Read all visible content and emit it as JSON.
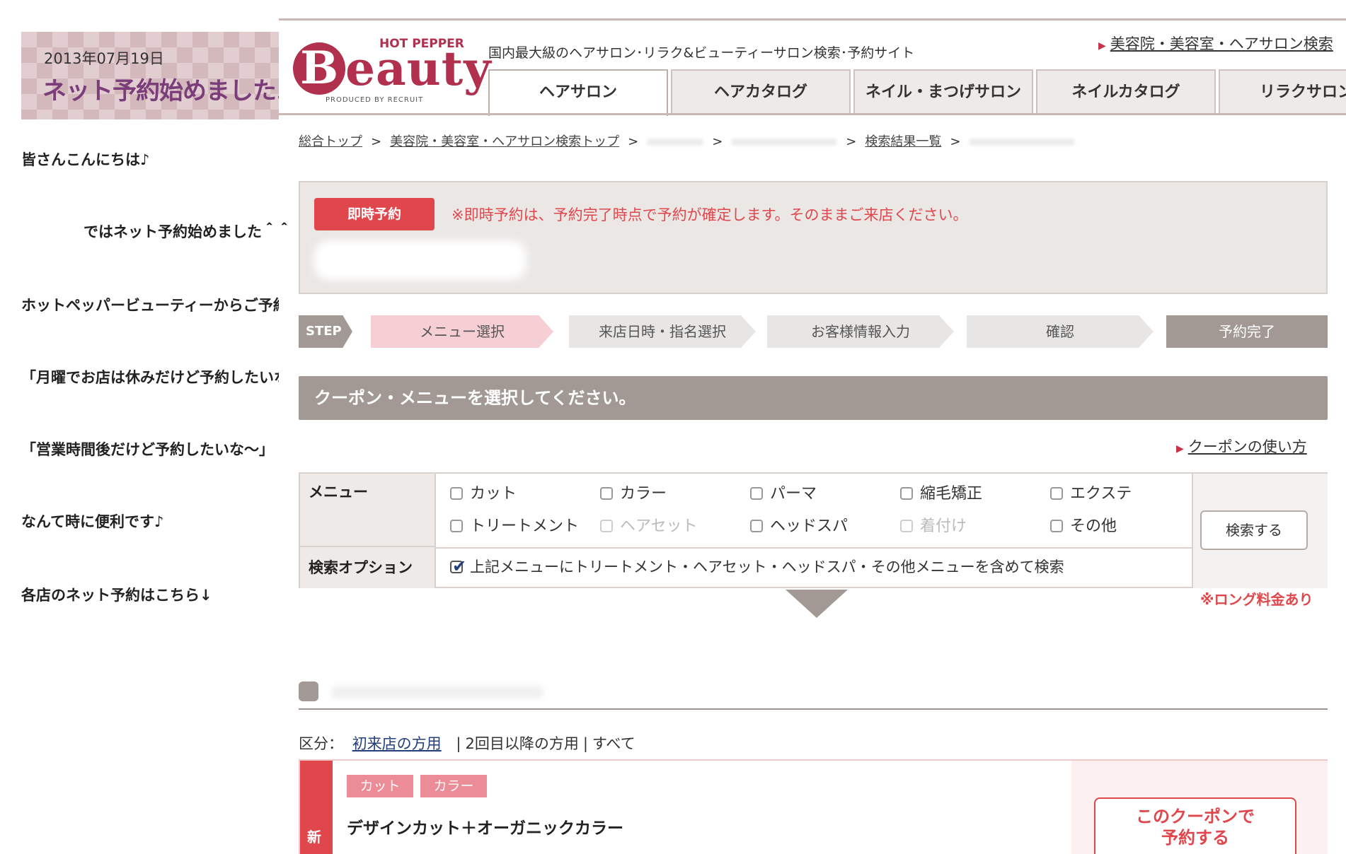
{
  "blog": {
    "date": "2013年07月19日",
    "title": "ネット予約始めました♪",
    "paragraphs": [
      "皆さんこんにちは♪",
      "ではネット予約始めました＾＾",
      "ホットペッパービューティーからご予約で",
      "「月曜でお店は休みだけど予約したいな",
      "「営業時間後だけど予約したいな〜」",
      "なんて時に便利です♪",
      "各店のネット予約はこちら↓"
    ]
  },
  "site": {
    "logo_top": "HOT PEPPER",
    "logo_initial": "B",
    "logo_word": "eauty",
    "logo_produced": "PRODUCED BY RECRUIT",
    "tagline": "国内最大級のヘアサロン･リラク&ビューティーサロン検索･予約サイト",
    "toplink": "美容院・美容室・ヘアサロン検索",
    "tabs": [
      "ヘアサロン",
      "ヘアカタログ",
      "ネイル・まつげサロン",
      "ネイルカタログ",
      "リラクサロン"
    ],
    "breadcrumb": {
      "top": "総合トップ",
      "search_top": "美容院・美容室・ヘアサロン検索トップ",
      "results": "検索結果一覧",
      "sep": ">"
    },
    "notice": {
      "instant_button": "即時予約",
      "text": "※即時予約は、予約完了時点で予約が確定します。そのままご来店ください。"
    },
    "steps": {
      "label": "STEP",
      "items": [
        "メニュー選択",
        "来店日時・指名選択",
        "お客様情報入力",
        "確認",
        "予約完了"
      ]
    },
    "section_title": "クーポン・メニューを選択してください。",
    "coupon_help_link": "クーポンの使い方",
    "menu": {
      "label": "メニュー",
      "options_row1": [
        "カット",
        "カラー",
        "パーマ",
        "縮毛矯正",
        "エクステ"
      ],
      "options_row2": [
        "トリートメント",
        "ヘアセット",
        "ヘッドスパ",
        "着付け",
        "その他"
      ],
      "option_label": "検索オプション",
      "option_text": "上記メニューにトリートメント・ヘアセット・ヘッドスパ・その他メニューを含めて検索",
      "search_button": "検索する"
    },
    "long_note": "※ロング料金あり",
    "category": {
      "label": "区分：",
      "first_time": "初来店の方用",
      "second": "2回目以降の方用",
      "all": "すべて",
      "divider": "|"
    },
    "coupon": {
      "new_badge": "新",
      "tags": [
        "カット",
        "カラー"
      ],
      "title": "デザインカット＋オーガニックカラー",
      "reserve_button": "このクーポンで\n予約する"
    }
  },
  "colors": {
    "brand": "#b0304e",
    "accent_red": "#e0474c",
    "step_gray": "#a29994",
    "step_active": "#f6cfd4",
    "blog_title": "#7a3d7a"
  }
}
